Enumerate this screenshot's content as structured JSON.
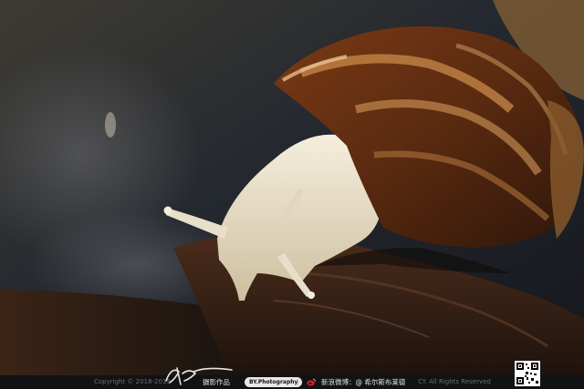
{
  "photo": {
    "subject": "snail-on-wood",
    "colors": {
      "shell_base": "#5a2c12",
      "shell_band": "#c98a4a",
      "body": "#efe6d2",
      "wood": "#3a2418",
      "background": "#23272d"
    }
  },
  "footer": {
    "copyright": "Copyright © 2018-2019",
    "works_label": "摄影作品",
    "handle_pill": "BY.Photography",
    "separator": "|",
    "weibo_text": "新浪微博：@ 希尔斯布莱德",
    "rights": "CY. All Rights Reserved",
    "icons": [
      "signature-logo",
      "weibo-icon",
      "qr-code"
    ]
  }
}
